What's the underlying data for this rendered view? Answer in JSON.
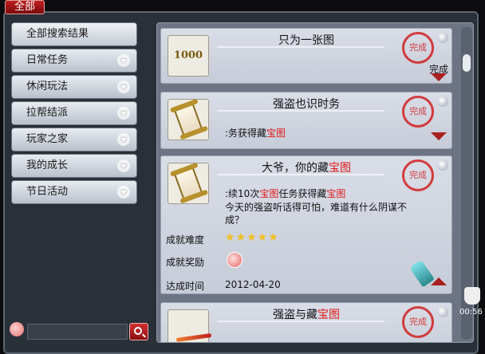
{
  "tab": {
    "label": "全部"
  },
  "sidebar": {
    "items": [
      {
        "label": "全部搜索结果",
        "has_chevron": false
      },
      {
        "label": "日常任务",
        "has_chevron": true
      },
      {
        "label": "休闲玩法",
        "has_chevron": true
      },
      {
        "label": "拉帮结派",
        "has_chevron": true
      },
      {
        "label": "玩家之家",
        "has_chevron": true
      },
      {
        "label": "我的成长",
        "has_chevron": true
      },
      {
        "label": "节日活动",
        "has_chevron": true
      }
    ]
  },
  "search": {
    "value": "",
    "placeholder": ""
  },
  "achievements": [
    {
      "title": "只为一张图",
      "thumb_text": "1000",
      "status": "完成",
      "stamp": "完成"
    },
    {
      "title": "强盗也识时务",
      "desc_pre": ":务获得藏",
      "desc_hl": "宝图",
      "stamp": "完成"
    },
    {
      "title_pre": "大爷，你的藏",
      "title_hl": "宝图",
      "desc_pre": ":续10次",
      "desc_hl1": "宝图",
      "desc_mid": "任务获得藏",
      "desc_hl2": "宝图",
      "flavor": "今天的强盗听话得可怕，难道有什么阴谋不成？",
      "difficulty_label": "成就难度",
      "difficulty_stars": "★★★★★",
      "reward_label": "成就奖励",
      "date_label": "达成时间",
      "date": "2012-04-20",
      "stamp": "完成"
    },
    {
      "title_pre": "强盗与藏",
      "title_hl": "宝图",
      "stamp": "完成"
    }
  ],
  "clock": {
    "time": "00:56"
  },
  "colors": {
    "highlight": "#e01818",
    "stamp": "#d22a2a",
    "tab": "#b01818"
  }
}
